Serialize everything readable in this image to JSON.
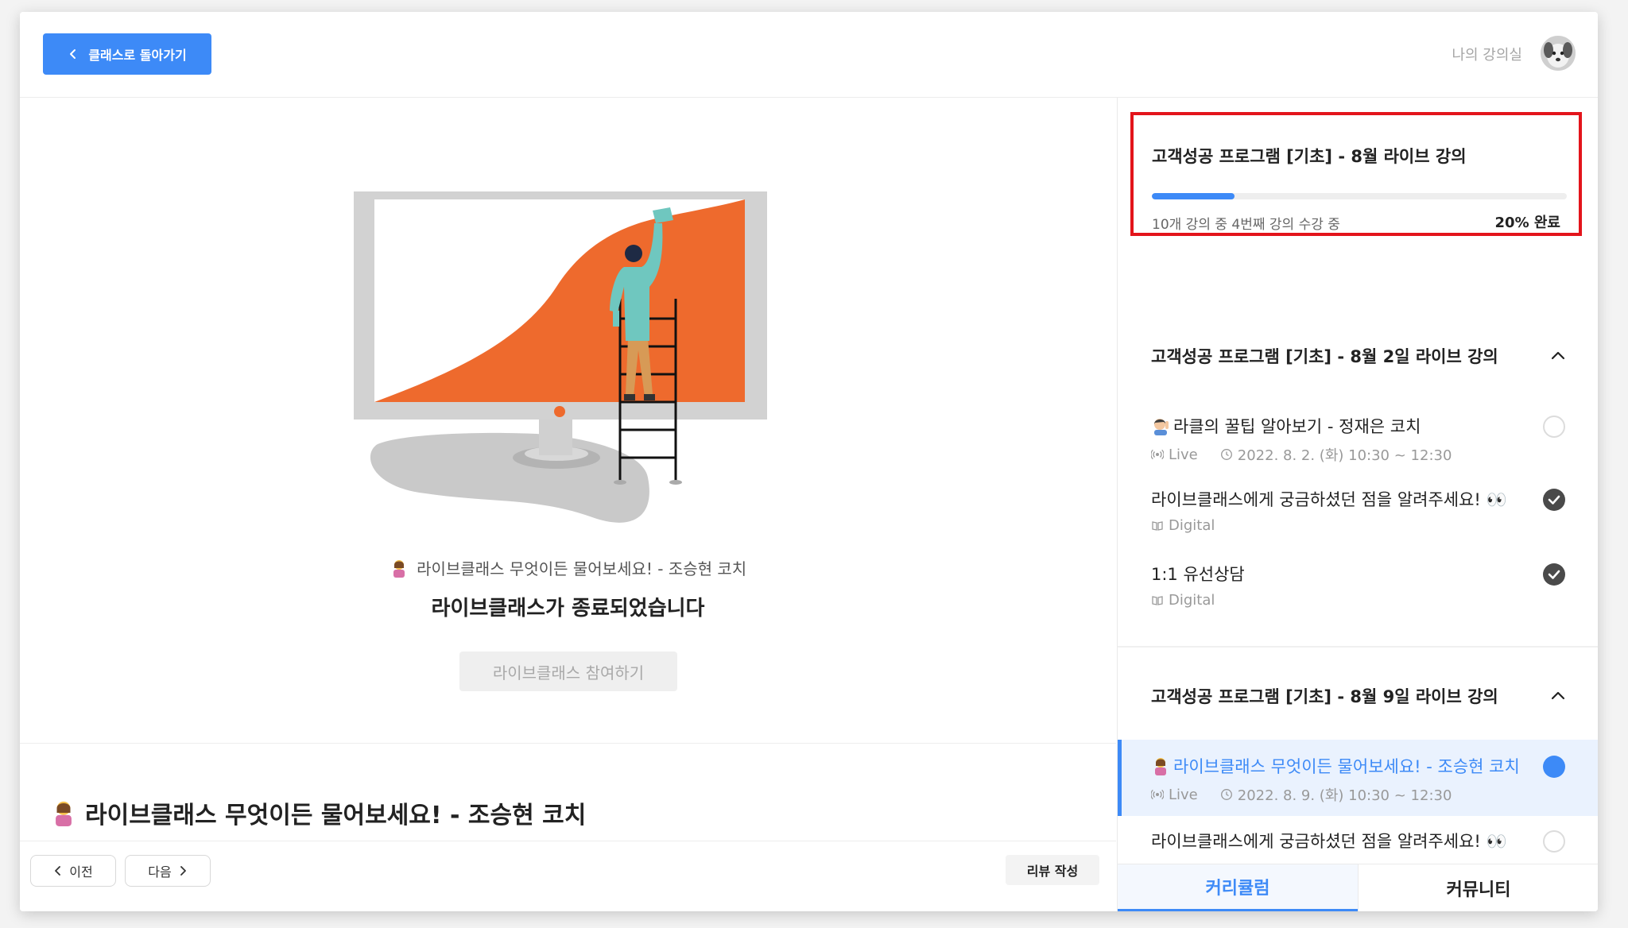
{
  "header": {
    "back_label": "클래스로 돌아가기",
    "my_classroom": "나의 강의실"
  },
  "player": {
    "lesson_subtitle": "라이브클래스 무엇이든 물어보세요! - 조승현 코치",
    "ended_message": "라이브클래스가 종료되었습니다",
    "join_button": "라이브클래스 참여하기"
  },
  "lesson": {
    "title": "라이브클래스 무엇이든 물어보세요! - 조승현 코치"
  },
  "nav": {
    "prev": "이전",
    "next": "다음",
    "review": "리뷰 작성"
  },
  "course": {
    "title": "고객성공 프로그램 [기초] - 8월 라이브 강의",
    "progress_text": "10개 강의 중 4번째 강의 수강 중",
    "progress_label": "20% 완료",
    "progress_fraction": 0.2
  },
  "sections": [
    {
      "title": "고객성공 프로그램 [기초] - 8월 2일 라이브 강의",
      "items": [
        {
          "title": "라클의 꿀팁 알아보기 - 정재은 코치",
          "type": "Live",
          "time": "2022. 8. 2. (화) 10:30 ~ 12:30",
          "status": "empty"
        },
        {
          "title": "라이브클래스에게 궁금하셨던 점을 알려주세요! 👀",
          "type": "Digital",
          "status": "done"
        },
        {
          "title": "1:1 유선상담",
          "type": "Digital",
          "status": "done"
        }
      ]
    },
    {
      "title": "고객성공 프로그램 [기초] - 8월 9일 라이브 강의",
      "items": [
        {
          "title": "라이브클래스 무엇이든 물어보세요! - 조승현 코치",
          "type": "Live",
          "time": "2022. 8. 9. (화) 10:30 ~ 12:30",
          "status": "current"
        },
        {
          "title": "라이브클래스에게 궁금하셨던 점을 알려주세요! 👀",
          "status": "empty"
        }
      ]
    }
  ],
  "tabs": {
    "curriculum": "커리큘럼",
    "community": "커뮤니티"
  },
  "colors": {
    "accent": "#3d8af7",
    "highlight_box": "#e3141b",
    "illustration_orange": "#ee6a2d"
  }
}
